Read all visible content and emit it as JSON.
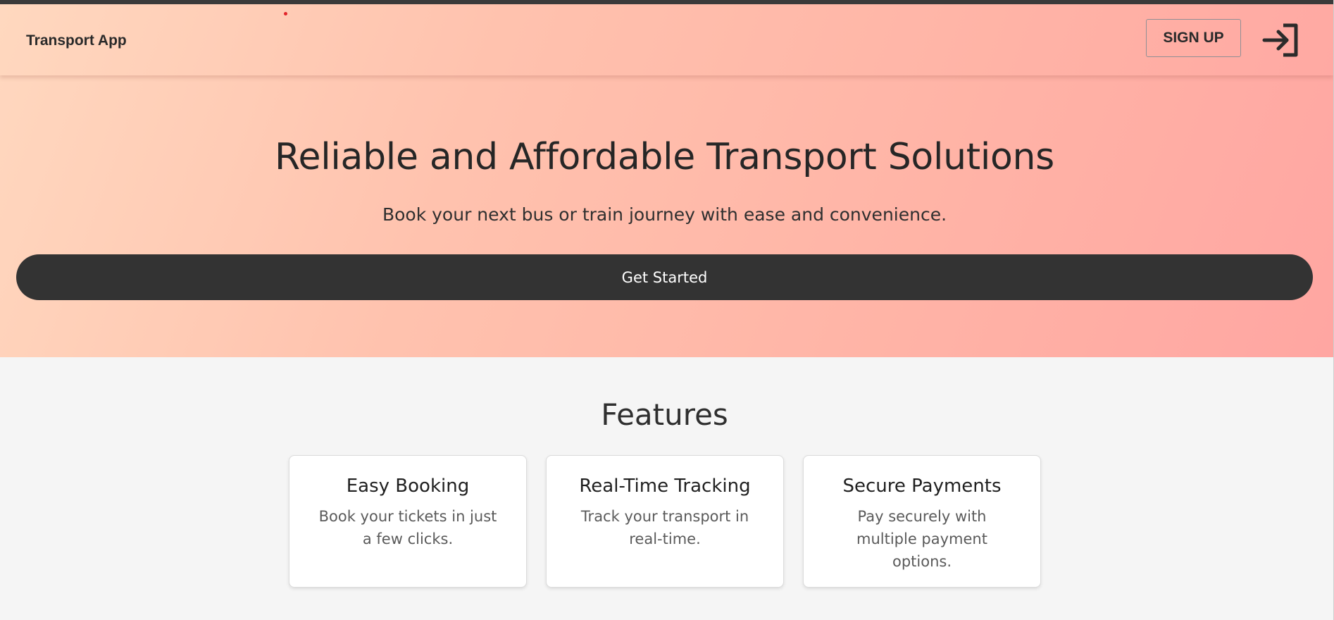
{
  "navbar": {
    "brand": "Transport App",
    "signup_label": "SIGN UP",
    "login_icon": "login-icon"
  },
  "hero": {
    "title": "Reliable and Affordable Transport Solutions",
    "subtitle": "Book your next bus or train journey with ease and convenience.",
    "cta_label": "Get Started"
  },
  "features": {
    "title": "Features",
    "cards": [
      {
        "title": "Easy Booking",
        "description": "Book your tickets in just a few clicks."
      },
      {
        "title": "Real-Time Tracking",
        "description": "Track your transport in real-time."
      },
      {
        "title": "Secure Payments",
        "description": "Pay securely with multiple payment options."
      }
    ]
  },
  "colors": {
    "hero_gradient_start": "#ffd8bf",
    "hero_gradient_end": "#ffa6a2",
    "cta_background": "#333333",
    "page_background": "#f5f5f5"
  }
}
